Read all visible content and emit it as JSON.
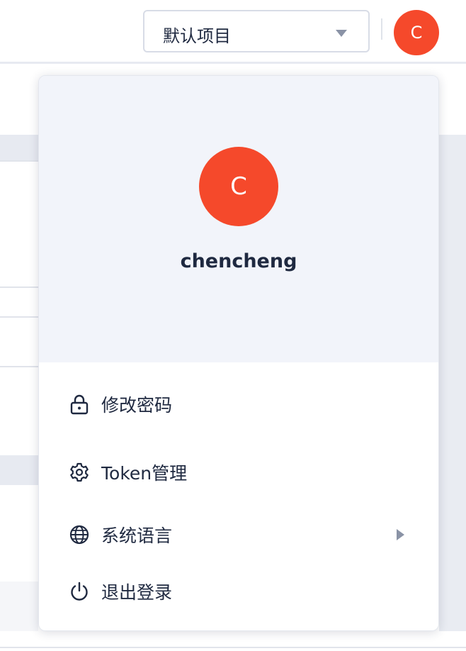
{
  "header": {
    "project_select": {
      "value": "默认项目"
    },
    "avatar_initial": "C"
  },
  "user_menu": {
    "avatar_initial": "C",
    "username": "chencheng",
    "items": [
      {
        "label": "修改密码",
        "icon": "lock-icon"
      },
      {
        "label": "Token管理",
        "icon": "gear-icon"
      },
      {
        "label": "系统语言",
        "icon": "globe-icon",
        "has_submenu": true
      },
      {
        "label": "退出登录",
        "icon": "power-icon"
      }
    ]
  },
  "colors": {
    "accent": "#f5492b",
    "text": "#1f2940",
    "panel_header_bg": "#f2f4fa"
  }
}
